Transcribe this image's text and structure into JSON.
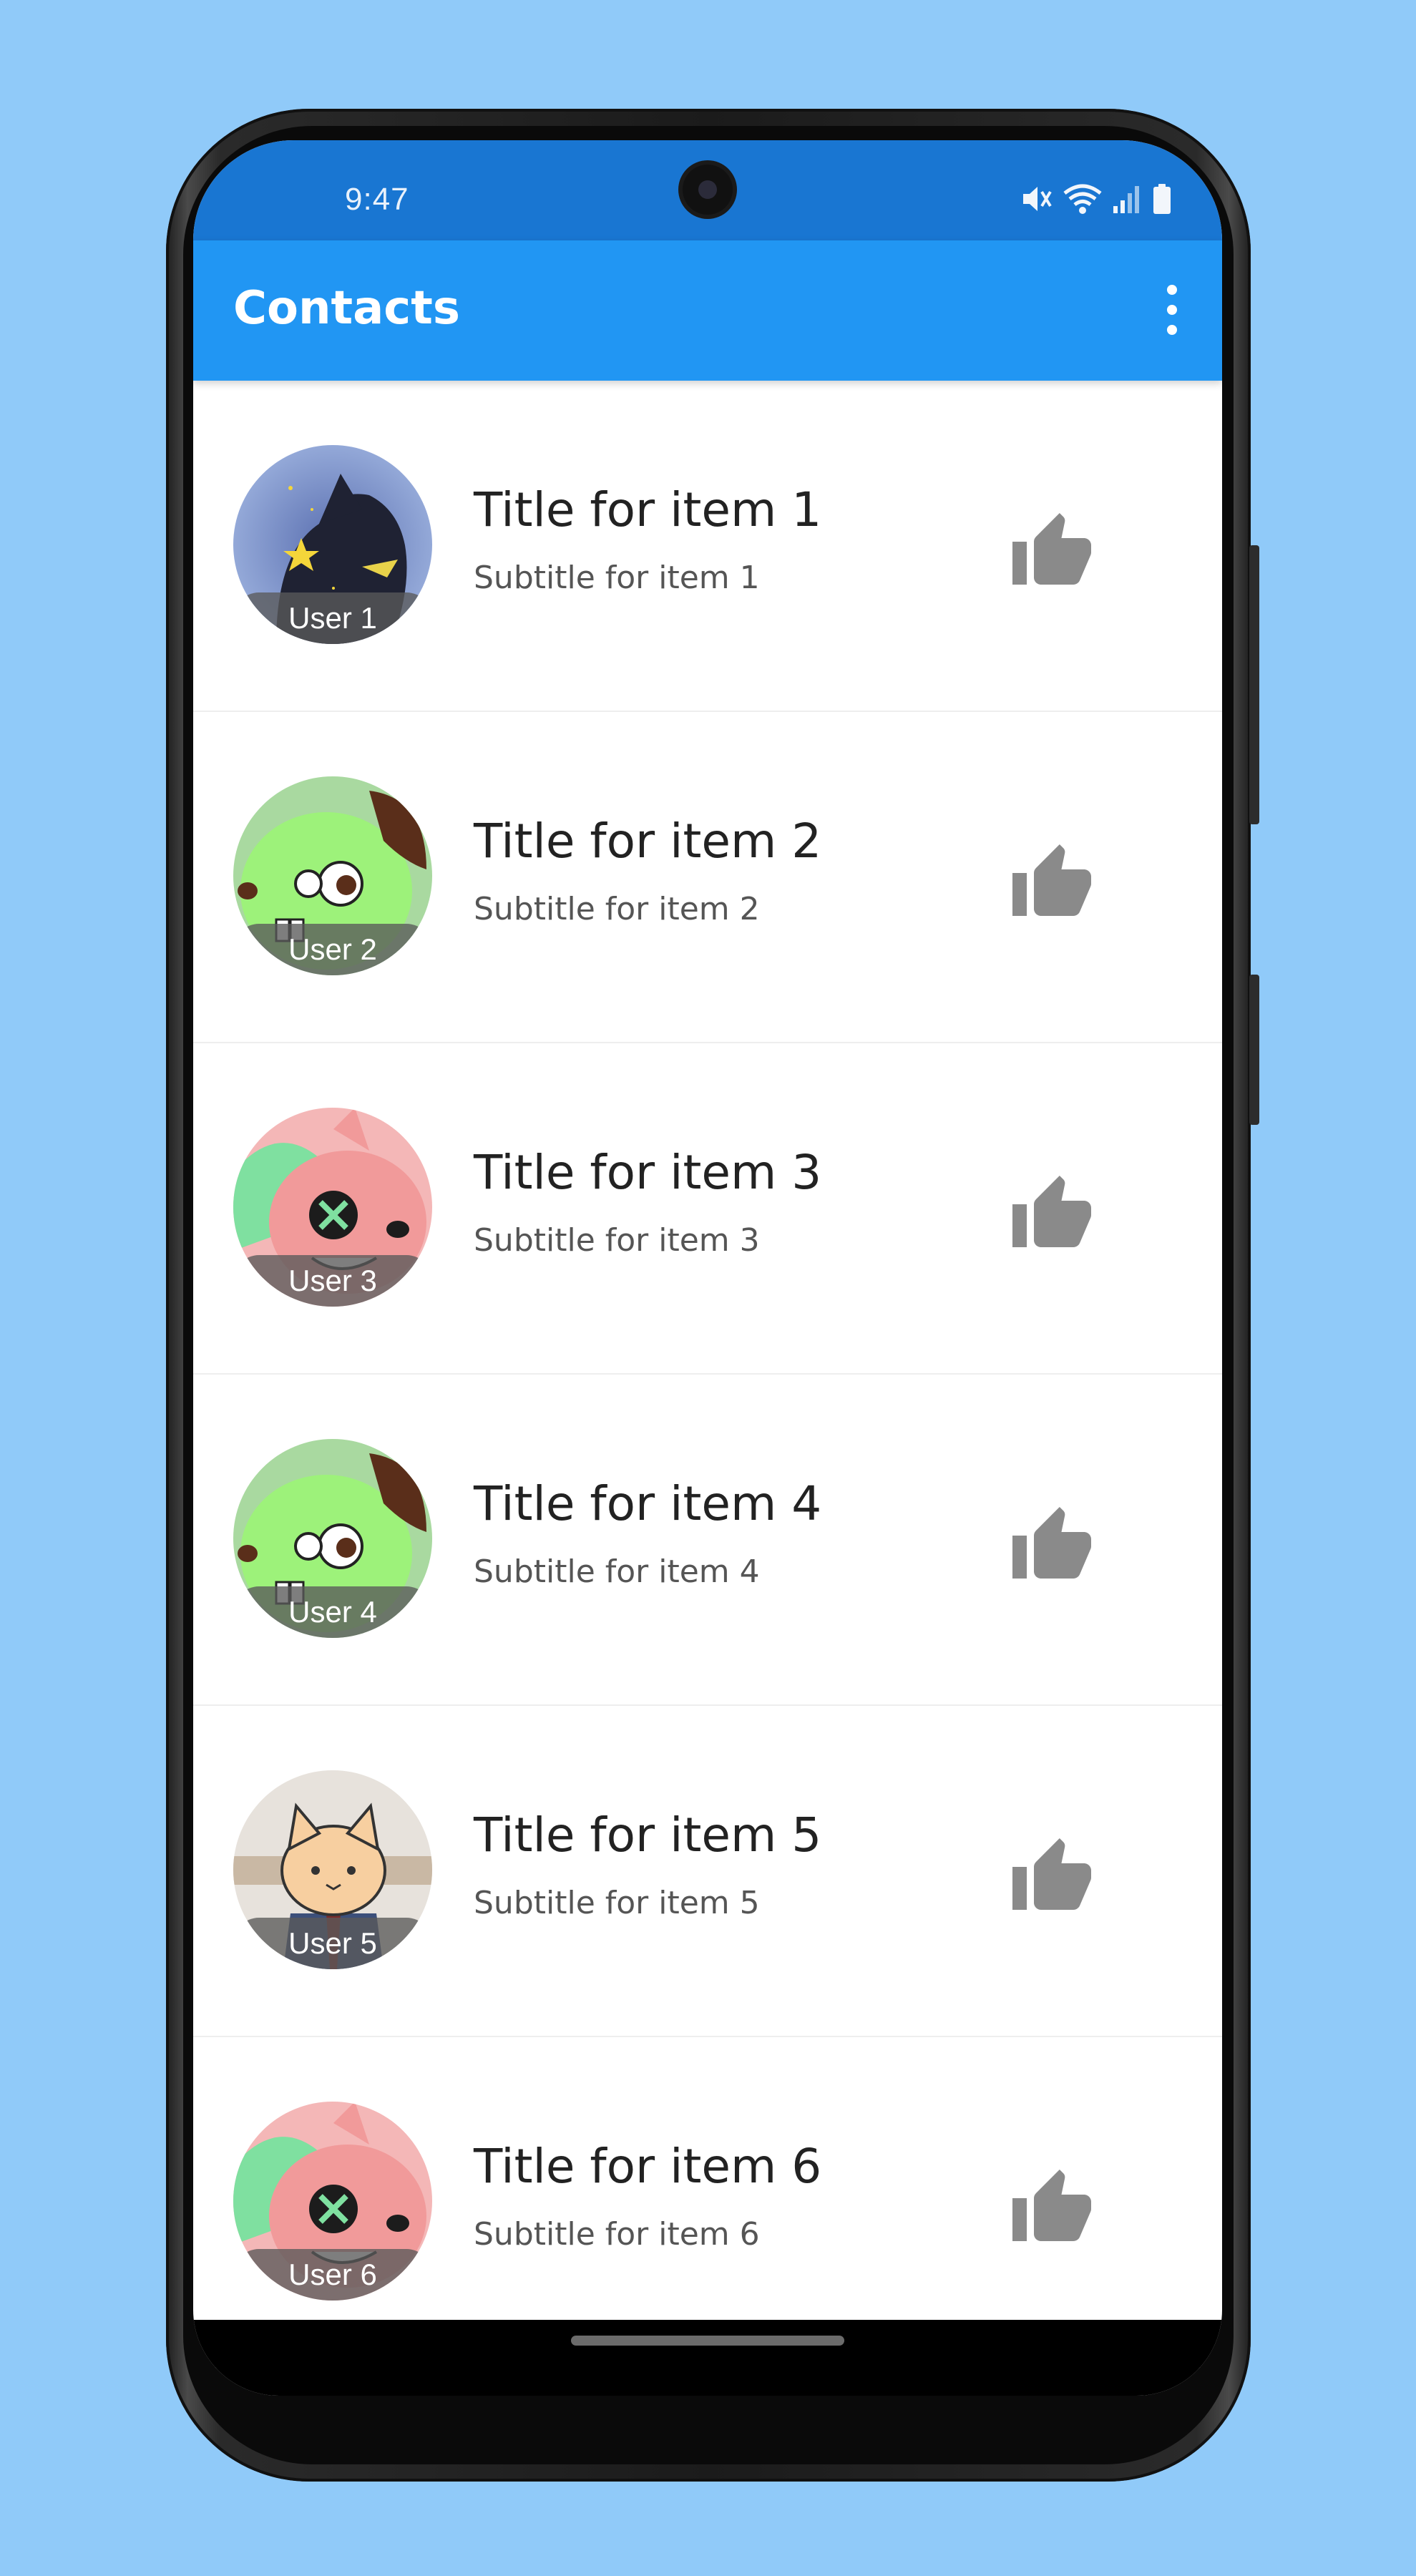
{
  "status_bar": {
    "time": "9:47",
    "icons": [
      "mute-icon",
      "wifi-icon",
      "signal-icon",
      "battery-icon"
    ]
  },
  "app_bar": {
    "title": "Contacts",
    "menu_icon": "more-vert-icon"
  },
  "colors": {
    "background": "#90CAF9",
    "status_bar": "#1976D2",
    "app_bar": "#2196F3",
    "like_icon": "#8a8a8a"
  },
  "items": [
    {
      "avatar_label": "User 1",
      "title": "Title for item 1",
      "subtitle": "Subtitle for item 1",
      "action_icon": "thumb-up-icon"
    },
    {
      "avatar_label": "User 2",
      "title": "Title for item 2",
      "subtitle": "Subtitle for item 2",
      "action_icon": "thumb-up-icon"
    },
    {
      "avatar_label": "User 3",
      "title": "Title for item 3",
      "subtitle": "Subtitle for item 3",
      "action_icon": "thumb-up-icon"
    },
    {
      "avatar_label": "User 4",
      "title": "Title for item 4",
      "subtitle": "Subtitle for item 4",
      "action_icon": "thumb-up-icon"
    },
    {
      "avatar_label": "User 5",
      "title": "Title for item 5",
      "subtitle": "Subtitle for item 5",
      "action_icon": "thumb-up-icon"
    },
    {
      "avatar_label": "User 6",
      "title": "Title for item 6",
      "subtitle": "Subtitle for item 6",
      "action_icon": "thumb-up-icon"
    }
  ]
}
